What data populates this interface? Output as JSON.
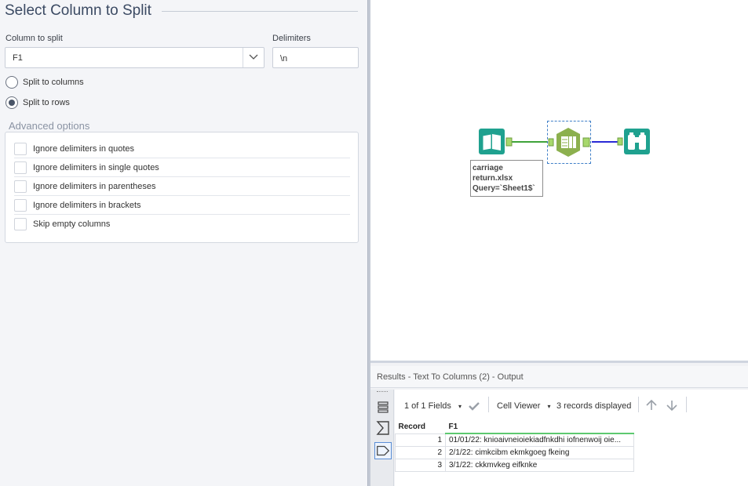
{
  "config": {
    "title": "Select Column to Split",
    "column_label": "Column to split",
    "column_value": "F1",
    "delimiters_label": "Delimiters",
    "delimiters_value": "\\n",
    "radios": [
      {
        "label": "Split to columns",
        "selected": false
      },
      {
        "label": "Split to rows",
        "selected": true
      }
    ],
    "advanced_title": "Advanced options",
    "options": [
      "Ignore delimiters in quotes",
      "Ignore delimiters in single quotes",
      "Ignore delimiters in parentheses",
      "Ignore delimiters in brackets",
      "Skip empty columns"
    ]
  },
  "canvas": {
    "input_label": [
      "carriage",
      "return.xlsx",
      "Query=`Sheet1$`"
    ],
    "colors": {
      "input": "#1fa18f",
      "transform": "#8cb04e",
      "browse": "#1fa18f",
      "link_green": "#3fa33a",
      "link_blue": "#2a2ad6"
    }
  },
  "results": {
    "title": "Results - Text To Columns (2) - Output",
    "fields": "1 of 1 Fields",
    "viewer": "Cell Viewer",
    "count": "3 records displayed",
    "columns": [
      "Record",
      "F1"
    ],
    "rows": [
      {
        "record": "1",
        "value": "01/01/22: knioaivneioiekiadfnkdhi iofnenwoij oie..."
      },
      {
        "record": "2",
        "value": "2/1/22: cimkcibm ekmkgoeg fkeing"
      },
      {
        "record": "3",
        "value": "3/1/22: ckkmvkeg eifknke"
      }
    ]
  }
}
